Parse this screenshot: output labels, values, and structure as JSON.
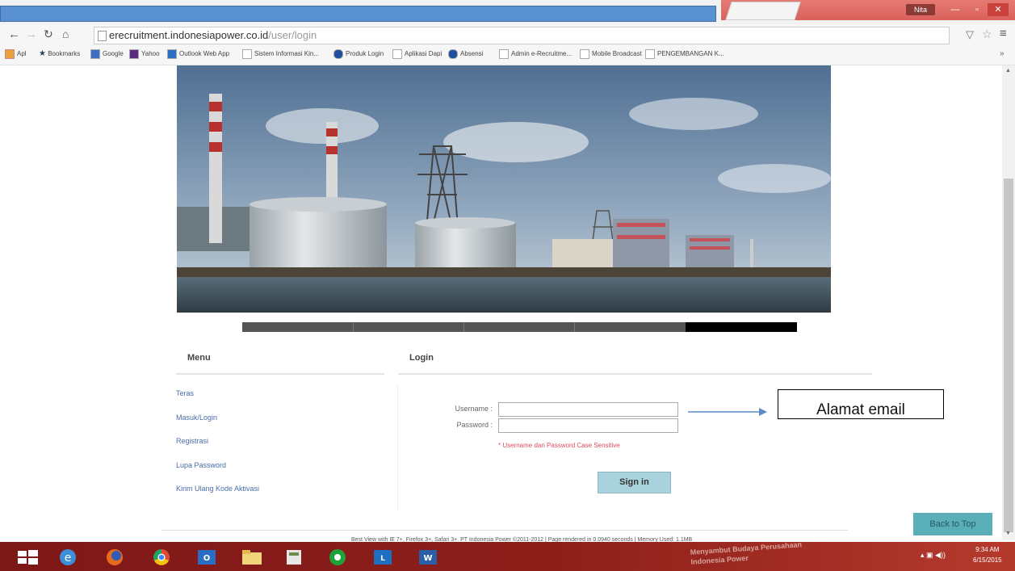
{
  "browser": {
    "url_host": "erecruitment.indonesiapower.co.id",
    "url_path": "/user/login",
    "user_badge": "Nita",
    "bookmarks": [
      "Apl",
      "Bookmarks",
      "Google",
      "Yahoo",
      "Outlook Web App",
      "Sistem Informasi Kin...",
      "Produk Login",
      "Aplikasi Dapi",
      "Absensi",
      "Admin e-Recruitme...",
      "Mobile Broadcast",
      "PENGEMBANGAN K..."
    ]
  },
  "menu": {
    "title": "Menu",
    "items": [
      "Teras",
      "Masuk/Login",
      "Registrasi",
      "Lupa Password",
      "Kirim Ulang Kode Aktivasi"
    ]
  },
  "login": {
    "title": "Login",
    "username_label": "Username :",
    "password_label": "Password :",
    "username_value": "",
    "password_value": "",
    "note": "* Username dan Password Case Sensitive",
    "signin_label": "Sign in"
  },
  "slideshow": {
    "active_slide": 5,
    "total_slides": 5
  },
  "callout": "Alamat email",
  "back_to_top": "Back to Top",
  "footer": "Best View with IE 7+, Firefox 3+, Safari 3+. PT Indonesia Power ©2011-2012 | Page rendered in 0.0940 seconds | Memory Used: 1.1MB",
  "taskbar": {
    "time": "9:34 AM",
    "date": "6/15/2015",
    "wallpaper_text": [
      "Menyambut Budaya Perusahaan",
      "Indonesia Power"
    ]
  },
  "colors": {
    "accent_button": "#a9d3dc",
    "back_to_top": "#5aaeb7",
    "note_red": "#e04b63",
    "link_blue": "#4a6da7"
  }
}
